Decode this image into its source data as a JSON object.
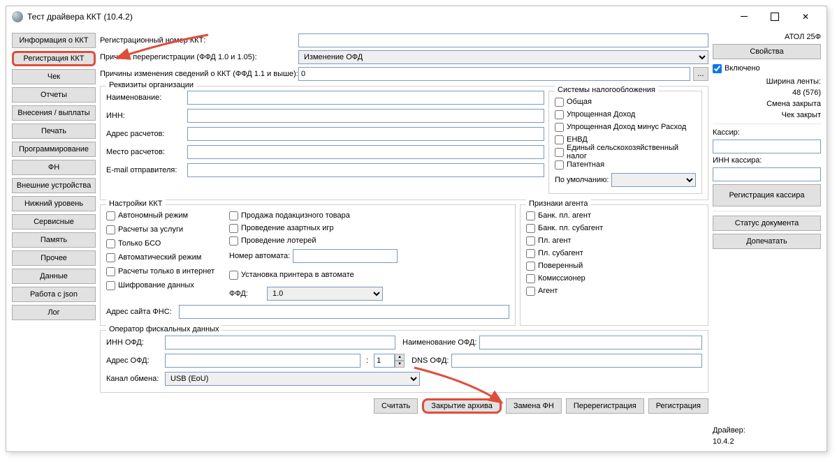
{
  "window": {
    "title": "Тест драйвера ККТ (10.4.2)"
  },
  "sidebar": {
    "items": [
      {
        "label": "Информация о ККТ"
      },
      {
        "label": "Регистрация ККТ",
        "hl": true
      },
      {
        "label": "Чек"
      },
      {
        "label": "Отчеты"
      },
      {
        "label": "Внесения / выплаты"
      },
      {
        "label": "Печать"
      },
      {
        "label": "Программирование"
      },
      {
        "label": "ФН"
      },
      {
        "label": "Внешние устройства"
      },
      {
        "label": "Нижний уровень"
      },
      {
        "label": "Сервисные"
      },
      {
        "label": "Память"
      },
      {
        "label": "Прочее"
      },
      {
        "label": "Данные"
      },
      {
        "label": "Работа с json"
      },
      {
        "label": "Лог"
      }
    ]
  },
  "top": {
    "reg_num_label": "Регистрационный номер ККТ:",
    "reg_num": "",
    "rereg_reason_label": "Причина перерегистрации (ФФД 1.0 и 1.05):",
    "rereg_reason": "Изменение ОФД",
    "change_reasons_label": "Причины изменения сведений о ККТ (ФФД 1.1 и выше):",
    "change_reasons": "0",
    "ell": "..."
  },
  "org": {
    "legend": "Реквизиты организации",
    "name_l": "Наименование:",
    "name": "",
    "inn_l": "ИНН:",
    "inn": "",
    "addr_l": "Адрес расчетов:",
    "addr": "",
    "place_l": "Место расчетов:",
    "place": "",
    "email_l": "E-mail отправителя:",
    "email": ""
  },
  "tax": {
    "legend": "Системы налогообложения",
    "items": [
      "Общая",
      "Упрощенная Доход",
      "Упрощенная Доход минус Расход",
      "ЕНВД",
      "Единый сельскохозяйственный налог",
      "Патентная"
    ],
    "default_l": "По умолчанию:",
    "default": ""
  },
  "kkt": {
    "legend": "Настройки ККТ",
    "c1": [
      "Автономный режим",
      "Расчеты за услуги",
      "Только БСО",
      "Автоматический режим",
      "Расчеты только в интернет",
      "Шифрование данных"
    ],
    "c2": [
      "Продажа подакцизного товара",
      "Проведение азартных игр",
      "Проведение лотерей"
    ],
    "machine_l": "Номер автомата:",
    "machine": "",
    "printer_chk": "Установка принтера в автомате",
    "ffd_l": "ФФД:",
    "ffd": "1.0",
    "fns_l": "Адрес сайта ФНС:",
    "fns": ""
  },
  "agent": {
    "legend": "Признаки агента",
    "items": [
      "Банк. пл. агент",
      "Банк. пл. субагент",
      "Пл. агент",
      "Пл. субагент",
      "Поверенный",
      "Комиссионер",
      "Агент"
    ]
  },
  "ofd": {
    "legend": "Оператор фискальных данных",
    "inn_l": "ИНН ОФД:",
    "inn": "",
    "name_l": "Наименование ОФД:",
    "name": "",
    "addr_l": "Адрес ОФД:",
    "addr": "",
    "port": "1",
    "dns_l": "DNS ОФД:",
    "dns": "",
    "chan_l": "Канал обмена:",
    "chan": "USB (EoU)"
  },
  "actions": {
    "read": "Считать",
    "close_arch": "Закрытие архива",
    "replace_fn": "Замена ФН",
    "rereg": "Перерегистрация",
    "reg": "Регистрация"
  },
  "right": {
    "device": "АТОЛ 25Ф",
    "props": "Свойства",
    "enabled": "Включено",
    "tape_l": "Ширина ленты:",
    "tape_v": "48 (576)",
    "shift": "Смена закрыта",
    "check": "Чек закрыт",
    "cashier_l": "Кассир:",
    "cashier": "",
    "cashier_inn_l": "ИНН кассира:",
    "cashier_inn": "",
    "reg_cashier": "Регистрация кассира",
    "doc_status": "Статус документа",
    "reprint": "Допечатать",
    "driver_l": "Драйвер:",
    "driver_v": "10.4.2"
  }
}
